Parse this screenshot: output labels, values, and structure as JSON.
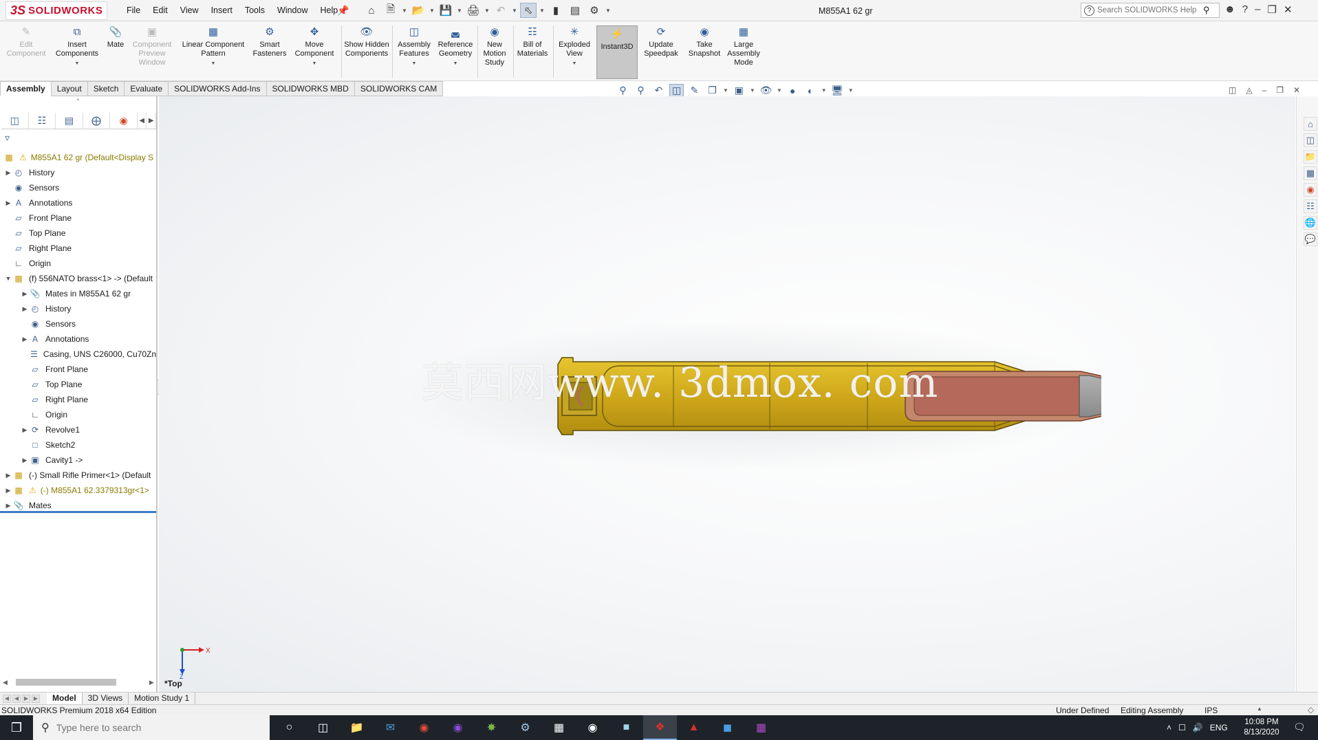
{
  "app": {
    "brand": "SOLIDWORKS",
    "brand_prefix": "3S",
    "document_title": "M855A1 62 gr",
    "menus": [
      "File",
      "Edit",
      "View",
      "Insert",
      "Tools",
      "Window",
      "Help"
    ],
    "search_placeholder": "Search SOLIDWORKS Help"
  },
  "commands": {
    "edit_component": "Edit Component",
    "insert_components": "Insert Components",
    "mate": "Mate",
    "component_preview": "Component Preview Window",
    "linear_pattern": "Linear Component Pattern",
    "smart_fasteners": "Smart Fasteners",
    "move_component": "Move Component",
    "show_hidden": "Show Hidden Components",
    "assembly_features": "Assembly Features",
    "reference_geometry": "Reference Geometry",
    "new_motion_study": "New Motion Study",
    "bill_of_materials": "Bill of Materials",
    "exploded_view": "Exploded View",
    "instant3d": "Instant3D",
    "update_speedpak": "Update Speedpak",
    "take_snapshot": "Take Snapshot",
    "large_assembly_mode": "Large Assembly Mode"
  },
  "tabs": [
    "Assembly",
    "Layout",
    "Sketch",
    "Evaluate",
    "SOLIDWORKS Add-Ins",
    "SOLIDWORKS MBD",
    "SOLIDWORKS CAM"
  ],
  "tree": {
    "root": "M855A1 62 gr  (Default<Display S",
    "items": [
      {
        "label": "History"
      },
      {
        "label": "Sensors"
      },
      {
        "label": "Annotations"
      },
      {
        "label": "Front Plane"
      },
      {
        "label": "Top Plane"
      },
      {
        "label": "Right Plane"
      },
      {
        "label": "Origin"
      },
      {
        "label": "(f) 556NATO brass<1> -> (Default"
      },
      {
        "label": "Mates in M855A1 62 gr"
      },
      {
        "label": "History"
      },
      {
        "label": "Sensors"
      },
      {
        "label": "Annotations"
      },
      {
        "label": "Casing, UNS C26000, Cu70Zn"
      },
      {
        "label": "Front Plane"
      },
      {
        "label": "Top Plane"
      },
      {
        "label": "Right Plane"
      },
      {
        "label": "Origin"
      },
      {
        "label": "Revolve1"
      },
      {
        "label": "Sketch2"
      },
      {
        "label": "Cavity1 ->"
      },
      {
        "label": "(-) Small Rifle Primer<1> (Default"
      },
      {
        "label": "(-) M855A1 62.3379313gr<1>"
      },
      {
        "label": "Mates"
      }
    ]
  },
  "graphics": {
    "watermark": "莫西网www. 3dmox. com",
    "view_label": "*Top",
    "triad_x": "X",
    "triad_z": "Z",
    "colors": {
      "brass": "#d8b21c",
      "brass_dark": "#8b7414",
      "powder": "#b5695a",
      "bullet_core": "#9b9b9b",
      "jacket": "#c4876b"
    }
  },
  "bottom_tabs": [
    "Model",
    "3D Views",
    "Motion Study 1"
  ],
  "status": {
    "edition": "SOLIDWORKS Premium 2018 x64 Edition",
    "state": "Under Defined",
    "mode": "Editing Assembly",
    "units": "IPS"
  },
  "taskbar": {
    "search_placeholder": "Type here to search",
    "language": "ENG",
    "time": "10:08 PM",
    "date": "8/13/2020"
  }
}
